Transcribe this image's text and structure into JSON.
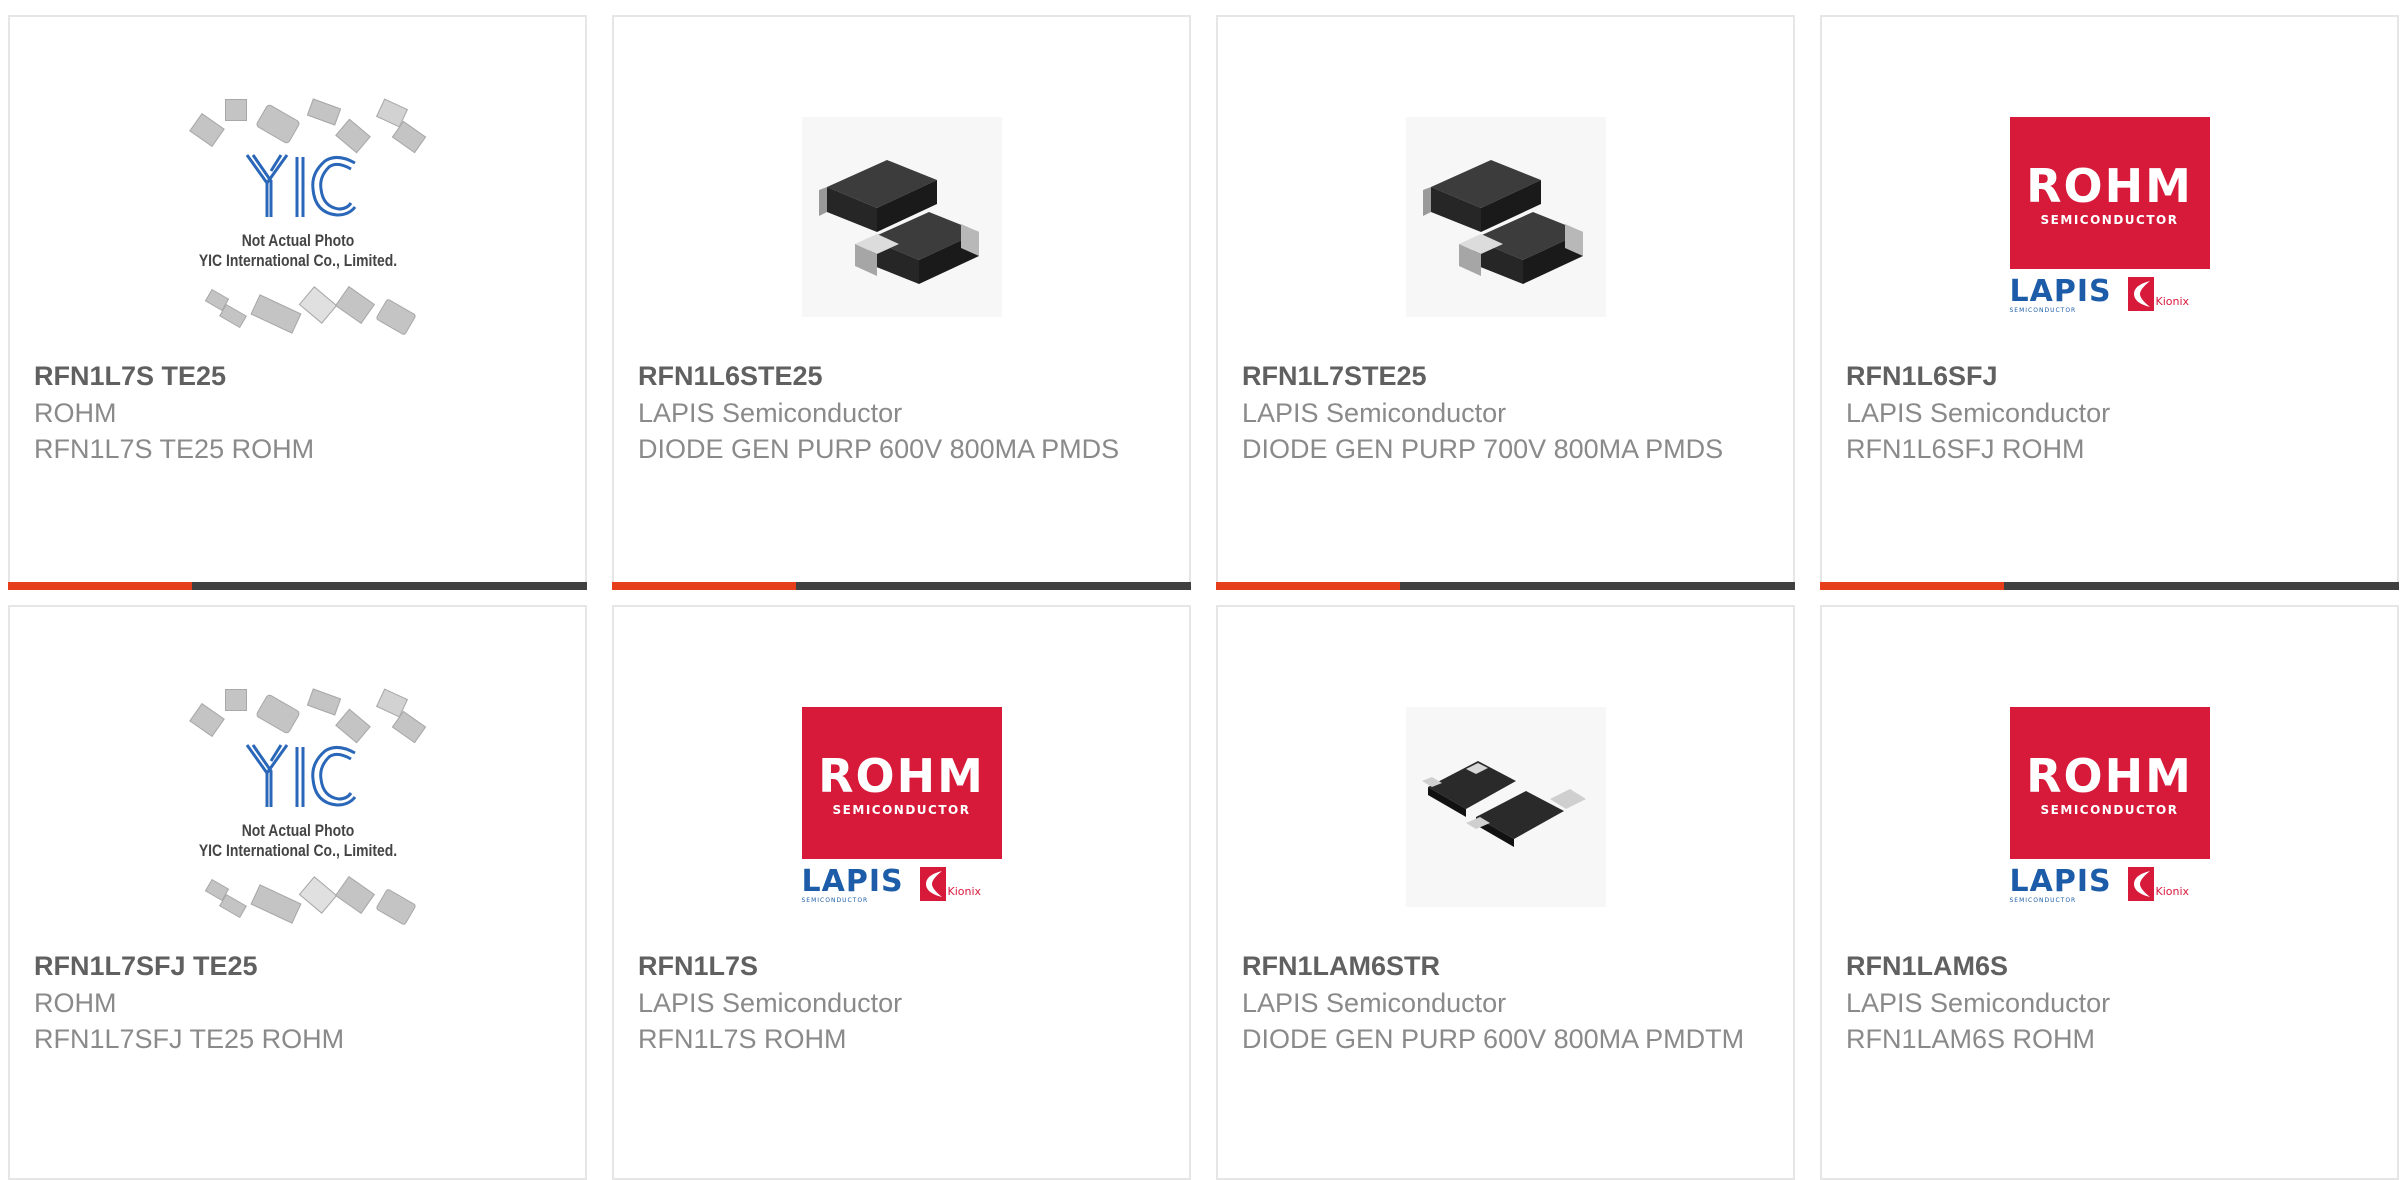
{
  "colors": {
    "accent": "#e63e1a",
    "bar": "#404040",
    "border": "#e6e6e6",
    "rohm_red": "#d7193a",
    "lapis_blue": "#1c5ca8"
  },
  "placeholder": {
    "icon": "yic-not-actual-photo",
    "line1": "Not Actual Photo",
    "line2": "YIC International Co., Limited."
  },
  "logo": {
    "rohm": "ROHM",
    "rohm_sub": "SEMICONDUCTOR",
    "lapis": "LAPIS",
    "lapis_sub": "SEMICONDUCTOR",
    "kionix": "Kionix"
  },
  "products": [
    {
      "part": "RFN1L7S TE25",
      "manufacturer": "ROHM",
      "description": "RFN1L7S TE25 ROHM",
      "image": "yic-placeholder"
    },
    {
      "part": "RFN1L6STE25",
      "manufacturer": "LAPIS Semiconductor",
      "description": "DIODE GEN PURP 600V 800MA PMDS",
      "image": "smd-diode-photo"
    },
    {
      "part": "RFN1L7STE25",
      "manufacturer": "LAPIS Semiconductor",
      "description": "DIODE GEN PURP 700V 800MA PMDS",
      "image": "smd-diode-photo"
    },
    {
      "part": "RFN1L6SFJ",
      "manufacturer": "LAPIS Semiconductor",
      "description": "RFN1L6SFJ ROHM",
      "image": "rohm-logo"
    },
    {
      "part": "RFN1L7SFJ TE25",
      "manufacturer": "ROHM",
      "description": "RFN1L7SFJ TE25 ROHM",
      "image": "yic-placeholder"
    },
    {
      "part": "RFN1L7S",
      "manufacturer": "LAPIS Semiconductor",
      "description": "RFN1L7S ROHM",
      "image": "rohm-logo"
    },
    {
      "part": "RFN1LAM6STR",
      "manufacturer": "LAPIS Semiconductor",
      "description": "DIODE GEN PURP 600V 800MA PMDTM",
      "image": "smd-diode-flat-photo"
    },
    {
      "part": "RFN1LAM6S",
      "manufacturer": "LAPIS Semiconductor",
      "description": "RFN1LAM6S ROHM",
      "image": "rohm-logo"
    }
  ]
}
